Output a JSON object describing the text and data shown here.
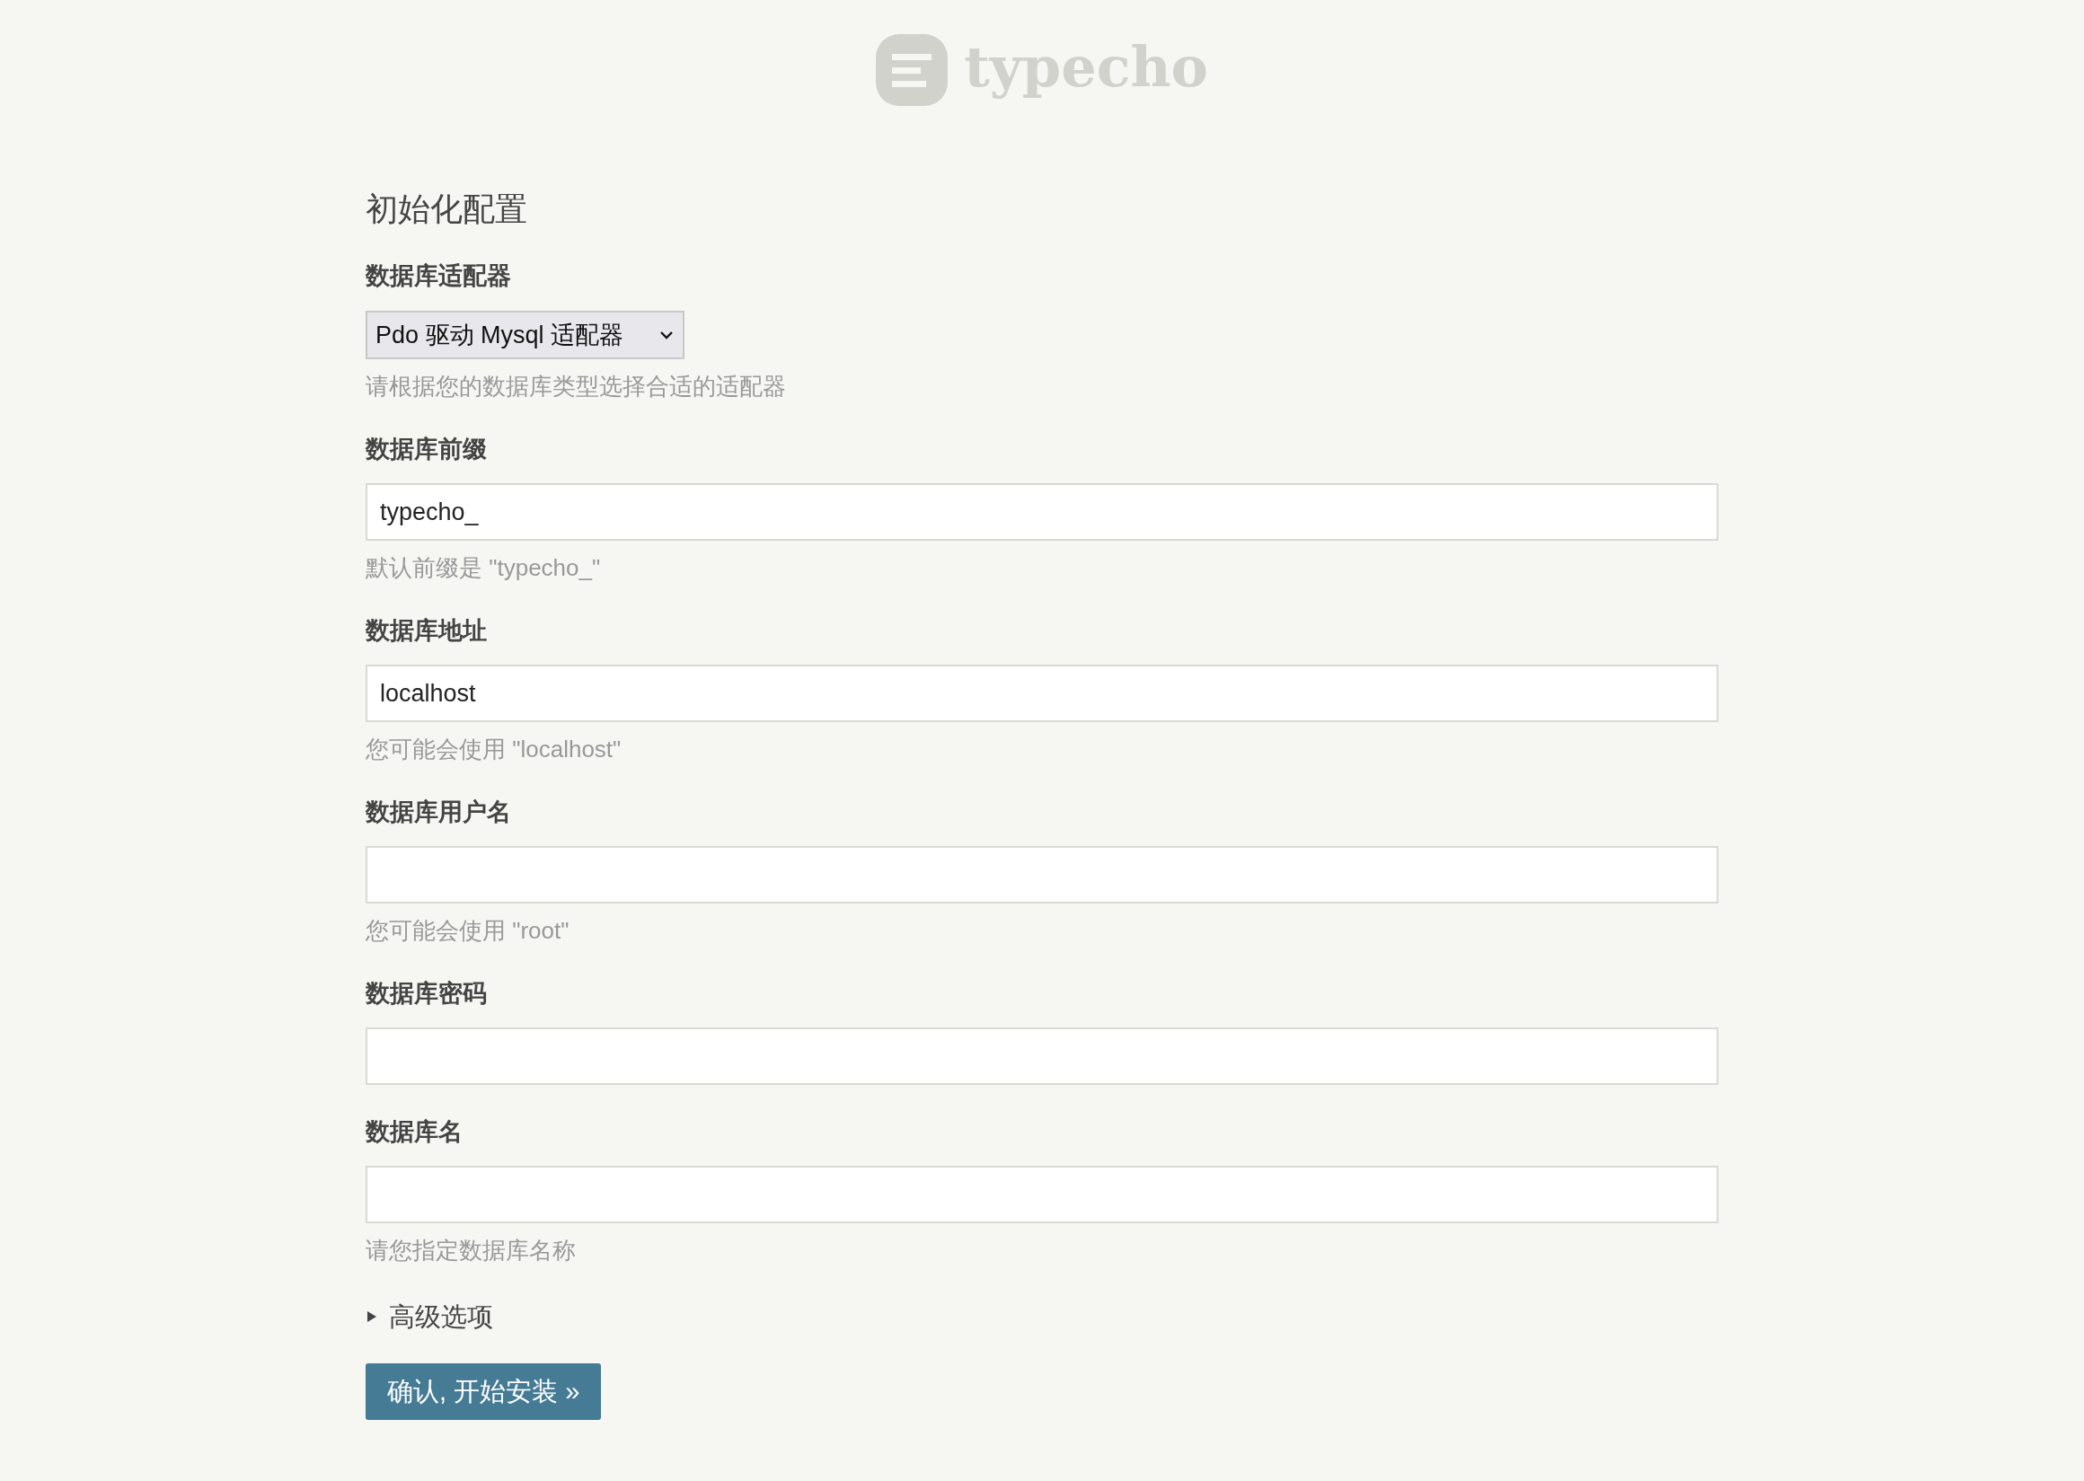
{
  "logo": {
    "text": "typecho"
  },
  "heading": "初始化配置",
  "fields": [
    {
      "kind": "select",
      "label": "数据库适配器",
      "value": "Pdo 驱动 Mysql 适配器",
      "hint": "请根据您的数据库类型选择合适的适配器"
    },
    {
      "kind": "text",
      "label": "数据库前缀",
      "value": "typecho_",
      "hint": "默认前缀是 \"typecho_\""
    },
    {
      "kind": "text",
      "label": "数据库地址",
      "value": "localhost",
      "hint": "您可能会使用 \"localhost\""
    },
    {
      "kind": "text",
      "label": "数据库用户名",
      "hint": "您可能会使用 \"root\""
    },
    {
      "kind": "password",
      "label": "数据库密码"
    },
    {
      "kind": "text",
      "label": "数据库名",
      "hint": "请您指定数据库名称"
    }
  ],
  "advanced": {
    "label": "高级选项",
    "expanded": false
  },
  "submit": "确认, 开始安装 »"
}
